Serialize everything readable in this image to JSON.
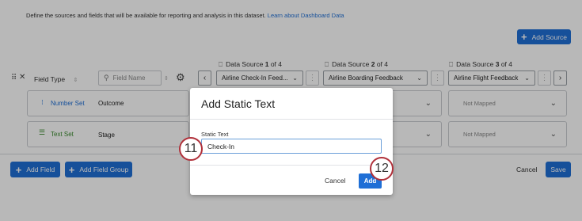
{
  "page": {
    "description": "Define the sources and fields that will be available for reporting and analysis in this dataset.",
    "learn_link": "Learn about Dashboard Data",
    "add_source_label": "Add Source",
    "field_type_label": "Field Type",
    "search_placeholder": "Field Name",
    "data_sources": [
      {
        "prefix": "Data Source ",
        "index": "1",
        "of": " of 4",
        "selected": "Airline Check-In Feed..."
      },
      {
        "prefix": "Data Source ",
        "index": "2",
        "of": " of 4",
        "selected": "Airline Boarding Feedback"
      },
      {
        "prefix": "Data Source ",
        "index": "3",
        "of": " of 4",
        "selected": "Airline Flight Feedback"
      }
    ],
    "rows": [
      {
        "type": "Number Set",
        "name": "Outcome",
        "mapping": "Not Mapped"
      },
      {
        "type": "Text Set",
        "name": "Stage",
        "mapping": "Not Mapped"
      }
    ],
    "add_field_label": "Add Field",
    "add_field_group_label": "Add Field Group",
    "cancel_label": "Cancel",
    "save_label": "Save"
  },
  "modal": {
    "title": "Add Static Text",
    "field_label": "Static Text",
    "input_value": "Check-In",
    "cancel_label": "Cancel",
    "add_label": "Add"
  },
  "markers": {
    "step_a": "11",
    "step_b": "12"
  },
  "colors": {
    "accent": "#1f6fd6",
    "marker_border": "#b0303a",
    "number_set": "#1f6fd6",
    "text_set": "#3a8a2e"
  }
}
